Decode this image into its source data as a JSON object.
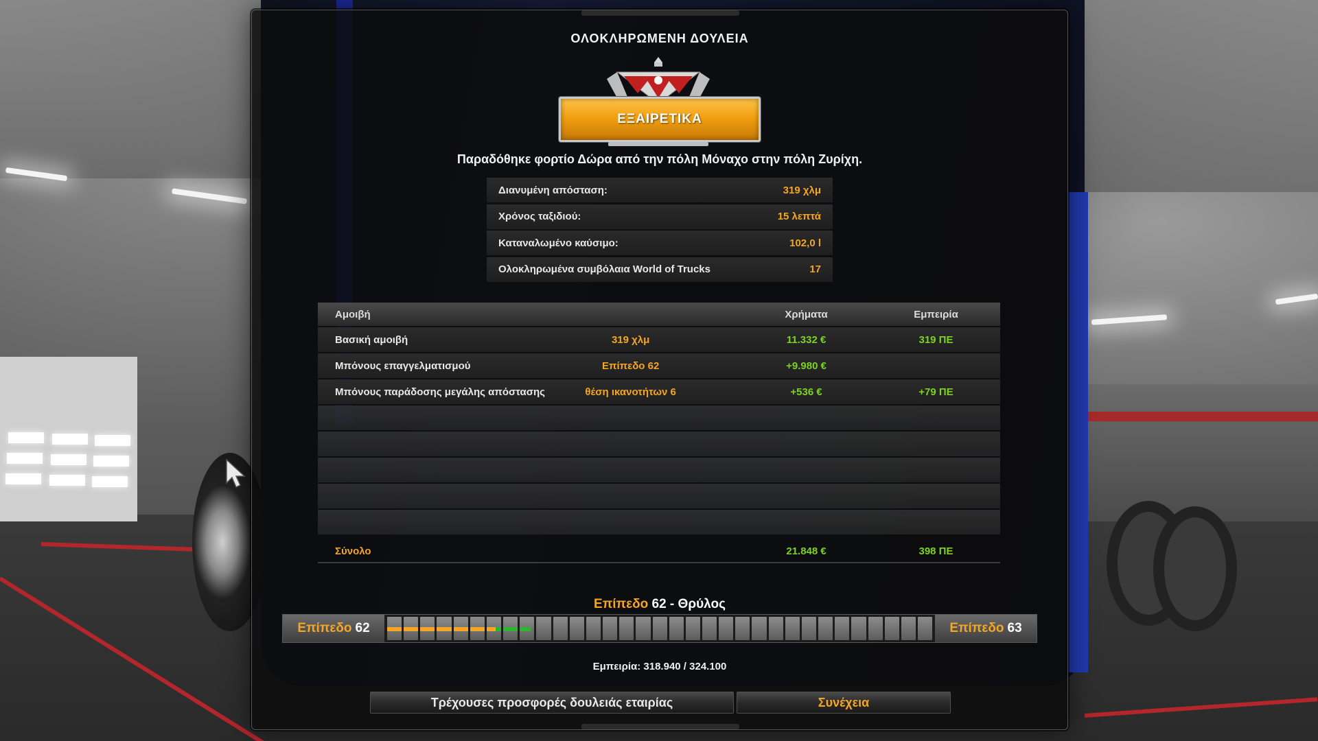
{
  "dialog": {
    "title": "ΟΛΟΚΛΗΡΩΜΕΝΗ ΔΟΥΛΕΙΑ",
    "rating": "ΕΞΑΙΡΕΤΙΚΑ",
    "delivery_message": "Παραδόθηκε φορτίο Δώρα από την πόλη Μόναχο στην πόλη Ζυρίχη."
  },
  "stats": [
    {
      "label": "Διανυμένη απόσταση:",
      "value": "319 χλμ"
    },
    {
      "label": "Χρόνος ταξιδιού:",
      "value": "15 λεπτά"
    },
    {
      "label": "Καταναλωμένο καύσιμο:",
      "value": "102,0 l"
    },
    {
      "label": "Ολοκληρωμένα συμβόλαια World of Trucks",
      "value": "17"
    }
  ],
  "rewards": {
    "header": {
      "name": "Αμοιβή",
      "money": "Χρήματα",
      "exp": "Εμπειρία"
    },
    "rows": [
      {
        "name": "Βασική αμοιβή",
        "detail": "319 χλμ",
        "money": "11.332 €",
        "exp": "319 ΠΕ"
      },
      {
        "name": "Μπόνους επαγγελματισμού",
        "detail": "Επίπεδο 62",
        "money": "+9.980 €",
        "exp": ""
      },
      {
        "name": "Μπόνους παράδοσης μεγάλης απόστασης",
        "detail": "θέση ικανοτήτων 6",
        "money": "+536 €",
        "exp": "+79 ΠΕ"
      }
    ],
    "total": {
      "name": "Σύνολο",
      "money": "21.848 €",
      "exp": "398 ΠΕ"
    }
  },
  "level": {
    "title_prefix": "Επίπεδο",
    "title_rest": "62 - Θρύλος",
    "current_word": "Επίπεδο",
    "current_num": "62",
    "next_word": "Επίπεδο",
    "next_num": "63",
    "previous_progress_fraction": 0.2,
    "gained_progress_fraction": 0.065,
    "experience_text": "Εμπειρία: 318.940 / 324.100"
  },
  "buttons": {
    "offers": "Τρέχουσες προσφορές δουλειάς εταιρίας",
    "continue": "Συνέχεια"
  },
  "colors": {
    "accent_orange": "#f5a623",
    "accent_green": "#7ed321",
    "rank_banner": "#f2a012"
  }
}
